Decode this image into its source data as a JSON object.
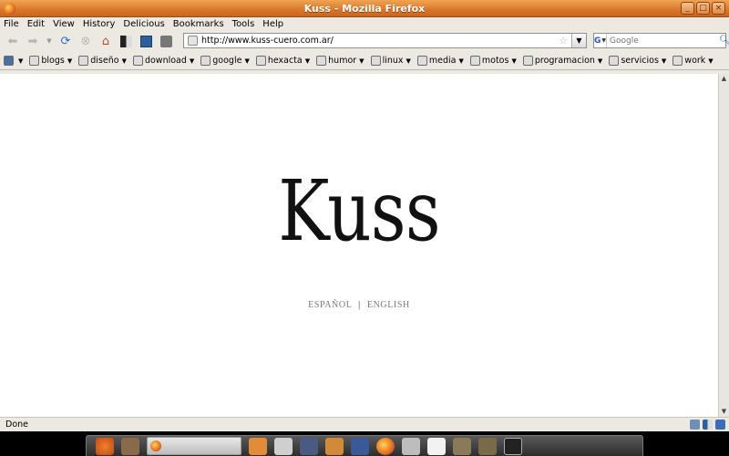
{
  "window": {
    "title": "Kuss - Mozilla Firefox",
    "controls": [
      "_",
      "□",
      "×"
    ]
  },
  "menu": [
    "File",
    "Edit",
    "View",
    "History",
    "Delicious",
    "Bookmarks",
    "Tools",
    "Help"
  ],
  "nav": {
    "url": "http://www.kuss-cuero.com.ar/",
    "search_placeholder": "Google",
    "search_engine": "G"
  },
  "bookmarks": [
    "blogs",
    "diseño",
    "download",
    "google",
    "hexacta",
    "humor",
    "linux",
    "media",
    "motos",
    "programacion",
    "servicios",
    "work"
  ],
  "page": {
    "logo": "Kuss",
    "lang_es": "ESPAÑOL",
    "lang_sep": "|",
    "lang_en": "ENGLISH"
  },
  "status": {
    "text": "Done"
  },
  "colors": {
    "titlebar": "#d8772b",
    "chrome": "#ece9e2"
  }
}
